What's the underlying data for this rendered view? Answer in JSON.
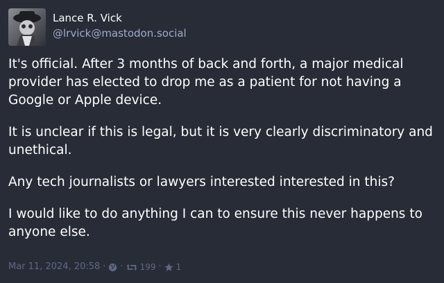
{
  "author": {
    "display_name": "Lance R. Vick",
    "handle": "@lrvick@mastodon.social"
  },
  "post": {
    "paragraphs": [
      "It's official. After 3 months of back and forth, a major medical provider has elected to drop me as a patient for not having a Google or Apple device.",
      "It is unclear if this is legal, but it is very clearly discriminatory and unethical.",
      "Any tech journalists or lawyers interested interested in this?",
      "I would like to do anything I can to ensure this never happens to anyone else."
    ]
  },
  "meta": {
    "timestamp": "Mar 11, 2024, 20:58",
    "separator": "·",
    "visibility_icon": "globe-icon",
    "boost_icon": "retweet-icon",
    "boost_count": "199",
    "favourite_icon": "star-icon",
    "favourite_count": "1"
  },
  "colors": {
    "background": "#282c37",
    "text": "#ffffff",
    "handle": "#9baec8",
    "meta": "#606984"
  }
}
